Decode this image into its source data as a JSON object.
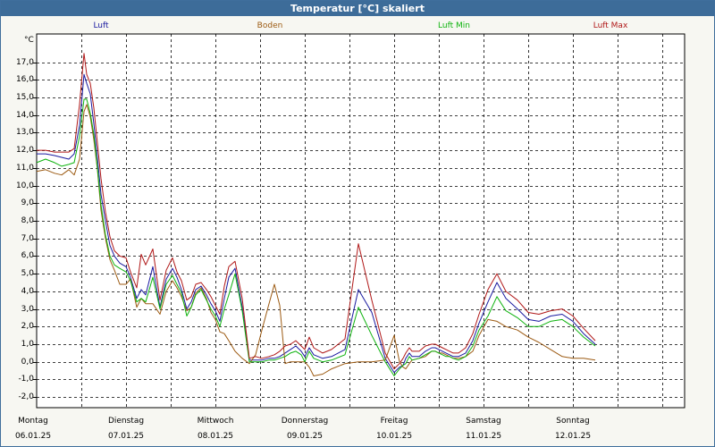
{
  "window": {
    "title": "Temperatur [°C] skaliert"
  },
  "chart_data": {
    "type": "line",
    "title": "Temperatur [°C] skaliert",
    "unit": "°C",
    "ylim": [
      -2.6,
      18.6
    ],
    "yticks": [
      -2.0,
      -1.0,
      0.0,
      1.0,
      2.0,
      3.0,
      4.0,
      5.0,
      6.0,
      7.0,
      8.0,
      9.0,
      10.0,
      11.0,
      12.0,
      13.0,
      14.0,
      15.0,
      16.0,
      17.0
    ],
    "ytick_labels": [
      "-2,0",
      "-1,0",
      "0,0",
      "1,0",
      "2,0",
      "3,0",
      "4,0",
      "5,0",
      "6,0",
      "7,0",
      "8,0",
      "9,0",
      "10,0",
      "11,0",
      "12,0",
      "13,0",
      "14,0",
      "15,0",
      "16,0",
      "17,0"
    ],
    "xlim": [
      0,
      7.25
    ],
    "x_unit": "days from 06.01.25 00:00",
    "grid": true,
    "legend_position": "top",
    "day_labels": [
      {
        "day": "Montag",
        "date": "06.01.25"
      },
      {
        "day": "Dienstag",
        "date": "07.01.25"
      },
      {
        "day": "Mittwoch",
        "date": "08.01.25"
      },
      {
        "day": "Donnerstag",
        "date": "09.01.25"
      },
      {
        "day": "Freitag",
        "date": "10.01.25"
      },
      {
        "day": "Samstag",
        "date": "11.01.25"
      },
      {
        "day": "Sonntag",
        "date": "12.01.25"
      }
    ],
    "x": [
      0,
      0.1,
      0.2,
      0.28,
      0.36,
      0.42,
      0.48,
      0.53,
      0.56,
      0.6,
      0.64,
      0.68,
      0.72,
      0.77,
      0.82,
      0.87,
      0.93,
      1.0,
      1.05,
      1.12,
      1.17,
      1.22,
      1.3,
      1.38,
      1.45,
      1.52,
      1.57,
      1.62,
      1.68,
      1.73,
      1.78,
      1.84,
      1.9,
      1.95,
      2.0,
      2.05,
      2.1,
      2.15,
      2.22,
      2.3,
      2.38,
      2.45,
      2.52,
      2.6,
      2.66,
      2.72,
      2.78,
      2.84,
      2.9,
      2.96,
      3.0,
      3.05,
      3.1,
      3.2,
      3.3,
      3.45,
      3.6,
      3.75,
      3.9,
      4.0,
      4.06,
      4.1,
      4.13,
      4.17,
      4.2,
      4.28,
      4.35,
      4.42,
      4.46,
      4.5,
      4.54,
      4.58,
      4.62,
      4.66,
      4.72,
      4.8,
      4.88,
      4.95,
      5.05,
      5.15,
      5.25,
      5.38,
      5.5,
      5.62,
      5.75,
      5.88,
      6.0,
      6.12,
      6.25,
      6.33,
      6.4,
      6.47,
      6.53,
      6.6,
      6.67,
      6.73,
      6.8,
      6.87,
      6.95,
      7.02,
      7.08,
      7.15,
      7.22,
      7.25
    ],
    "series": [
      {
        "name": "Luft",
        "color": "#1a1aa0",
        "values": [
          11.8,
          11.8,
          11.7,
          11.6,
          11.5,
          11.8,
          13.4,
          16.3,
          15.8,
          15.2,
          13.5,
          11.6,
          9.5,
          8.0,
          6.6,
          6.0,
          5.6,
          5.4,
          4.8,
          3.6,
          4.1,
          3.8,
          5.4,
          3.1,
          4.7,
          5.3,
          4.8,
          4.1,
          3.0,
          3.4,
          4.1,
          4.3,
          3.8,
          3.3,
          2.9,
          2.3,
          3.6,
          4.8,
          5.3,
          3.1,
          0.1,
          0.1,
          0.1,
          0.2,
          0.2,
          0.3,
          0.5,
          0.7,
          0.9,
          0.6,
          0.3,
          0.8,
          0.4,
          0.2,
          0.3,
          0.7,
          4.1,
          2.8,
          0.2,
          -0.6,
          -0.3,
          -0.2,
          0.2,
          0.5,
          0.3,
          0.3,
          0.6,
          0.8,
          0.8,
          0.7,
          0.6,
          0.5,
          0.4,
          0.3,
          0.3,
          0.5,
          1.2,
          2.2,
          3.4,
          4.5,
          3.6,
          3.0,
          2.4,
          2.3,
          2.6,
          2.7,
          2.3,
          1.6,
          1.0
        ]
      },
      {
        "name": "Boden",
        "color": "#9c5a12",
        "values": [
          10.8,
          10.9,
          10.7,
          10.6,
          10.9,
          10.6,
          11.5,
          14.2,
          14.6,
          13.9,
          12.6,
          10.9,
          8.6,
          7.0,
          5.8,
          5.2,
          4.4,
          4.4,
          4.7,
          3.1,
          3.6,
          3.3,
          3.3,
          2.7,
          4.0,
          4.6,
          4.2,
          3.7,
          2.9,
          3.1,
          3.9,
          4.2,
          3.6,
          2.8,
          2.4,
          1.7,
          1.6,
          1.2,
          0.6,
          0.2,
          -0.1,
          0.4,
          1.8,
          3.3,
          4.4,
          3.2,
          -0.1,
          0.0,
          0.0,
          0.0,
          0.0,
          -0.3,
          -0.8,
          -0.7,
          -0.4,
          -0.1,
          0.0,
          0.0,
          0.1,
          1.5,
          0.0,
          -0.3,
          -0.4,
          -0.1,
          0.1,
          0.2,
          0.3,
          0.6,
          0.6,
          0.5,
          0.5,
          0.4,
          0.3,
          0.2,
          0.2,
          0.3,
          0.6,
          1.5,
          2.4,
          2.3,
          2.0,
          1.8,
          1.4,
          1.1,
          0.7,
          0.3,
          0.2,
          0.2,
          0.1
        ]
      },
      {
        "name": "Luft Min",
        "color": "#0fb30f",
        "values": [
          11.3,
          11.5,
          11.3,
          11.1,
          11.2,
          11.3,
          12.8,
          14.9,
          14.9,
          14.1,
          12.9,
          11.0,
          8.9,
          7.2,
          6.0,
          5.5,
          5.3,
          5.1,
          4.6,
          3.4,
          3.6,
          3.4,
          4.8,
          3.0,
          4.4,
          4.9,
          4.4,
          3.9,
          2.6,
          3.1,
          3.8,
          4.1,
          3.5,
          3.0,
          2.6,
          2.0,
          3.0,
          3.8,
          5.0,
          2.9,
          0.0,
          0.0,
          0.0,
          0.1,
          0.1,
          0.2,
          0.3,
          0.5,
          0.6,
          0.4,
          0.0,
          0.6,
          0.2,
          0.0,
          0.1,
          0.4,
          3.1,
          1.5,
          0.0,
          -0.8,
          -0.4,
          -0.2,
          -0.1,
          0.3,
          0.1,
          0.2,
          0.4,
          0.6,
          0.6,
          0.5,
          0.4,
          0.3,
          0.3,
          0.2,
          0.1,
          0.3,
          0.9,
          1.8,
          2.6,
          3.7,
          2.9,
          2.5,
          2.0,
          2.0,
          2.3,
          2.4,
          2.0,
          1.4,
          0.9
        ]
      },
      {
        "name": "Luft Max",
        "color": "#b01818",
        "values": [
          12.0,
          12.0,
          11.9,
          11.9,
          11.9,
          12.1,
          14.6,
          17.5,
          16.3,
          15.8,
          14.4,
          12.4,
          10.4,
          8.5,
          7.1,
          6.3,
          6.0,
          5.9,
          5.1,
          4.2,
          6.1,
          5.5,
          6.4,
          3.5,
          5.2,
          5.9,
          5.1,
          4.6,
          3.5,
          3.7,
          4.4,
          4.5,
          4.1,
          3.7,
          3.2,
          2.7,
          4.3,
          5.4,
          5.7,
          3.6,
          0.2,
          0.3,
          0.2,
          0.3,
          0.4,
          0.6,
          0.9,
          1.0,
          1.2,
          0.9,
          0.7,
          1.4,
          0.8,
          0.5,
          0.7,
          1.3,
          6.7,
          3.5,
          0.5,
          -0.4,
          -0.1,
          0.2,
          0.5,
          0.8,
          0.6,
          0.6,
          0.9,
          1.0,
          1.0,
          0.9,
          0.8,
          0.7,
          0.6,
          0.5,
          0.5,
          0.8,
          1.6,
          2.7,
          4.1,
          5.0,
          4.0,
          3.5,
          2.8,
          2.7,
          2.9,
          3.0,
          2.6,
          1.9,
          1.2
        ]
      }
    ]
  }
}
